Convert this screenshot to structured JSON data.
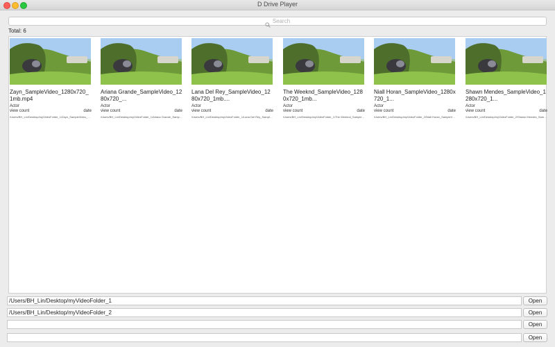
{
  "window": {
    "title": "D Drive Player"
  },
  "search": {
    "placeholder": "Search",
    "icon": "search-icon"
  },
  "total_label": "Total: 6",
  "videos": [
    {
      "title": "Zayn_SampleVideo_1280x720_1mb.mp4",
      "actor": "Actor",
      "view_count": "view count",
      "date": "date",
      "path": "/Users/BH_Lin/Desktop/myVideoFolder_1/Zayn_SampleVideo_1280..."
    },
    {
      "title": "Ariana Grande_SampleVideo_1280x720_...",
      "actor": "Actor",
      "view_count": "view count",
      "date": "date",
      "path": "/Users/BH_Lin/Desktop/myVideoFolder_1/Ariana Grande_SampleVid..."
    },
    {
      "title": "Lana Del Rey_SampleVideo_1280x720_1mb....",
      "actor": "Actor",
      "view_count": "view count",
      "date": "date",
      "path": "/Users/BH_Lin/Desktop/myVideoFolder_1/Lana Del Rey_SampleVid..."
    },
    {
      "title": "The Weeknd_SampleVideo_1280x720_1mb...",
      "actor": "Actor",
      "view_count": "view count",
      "date": "date",
      "path": "/Users/BH_Lin/Desktop/myVideoFolder_1/The Weeknd_SampleVid..."
    },
    {
      "title": "Niall Horan_SampleVideo_1280x720_1...",
      "actor": "Actor",
      "view_count": "view count",
      "date": "date",
      "path": "/Users/BH_Lin/Desktop/myVideoFolder_2/Niall Horan_SampleVid..."
    },
    {
      "title": "Shawn Mendes_SampleVideo_1280x720_1...",
      "actor": "Actor",
      "view_count": "view count",
      "date": "date",
      "path": "/Users/BH_Lin/Desktop/myVideoFolder_2/Shawn Mendes_SampleVid..."
    }
  ],
  "folders": [
    {
      "path": "/Users/BH_Lin/Desktop/myVideoFolder_1",
      "button": "Open"
    },
    {
      "path": "/Users/BH_Lin/Desktop/myVideoFolder_2",
      "button": "Open"
    },
    {
      "path": "",
      "button": "Open"
    },
    {
      "path": "",
      "button": "Open"
    }
  ]
}
